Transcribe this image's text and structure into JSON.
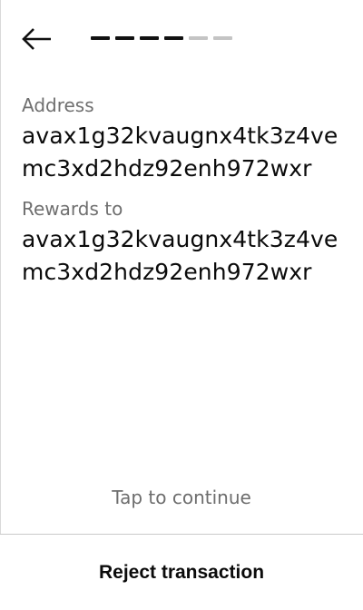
{
  "header": {
    "back_icon": "arrow-left-icon",
    "progress": {
      "total_steps": 6,
      "completed_steps": 4,
      "completed_color": "#111111",
      "pending_color": "#c4c4c4"
    }
  },
  "fields": [
    {
      "label": "Address",
      "value": "avax1g32kvaugnx4tk3z4vemc3xd2hdz92enh972wxr"
    },
    {
      "label": "Rewards to",
      "value": "avax1g32kvaugnx4tk3z4vemc3xd2hdz92enh972wxr"
    }
  ],
  "footer": {
    "tap_hint": "Tap to continue",
    "reject_label": "Reject transaction"
  }
}
